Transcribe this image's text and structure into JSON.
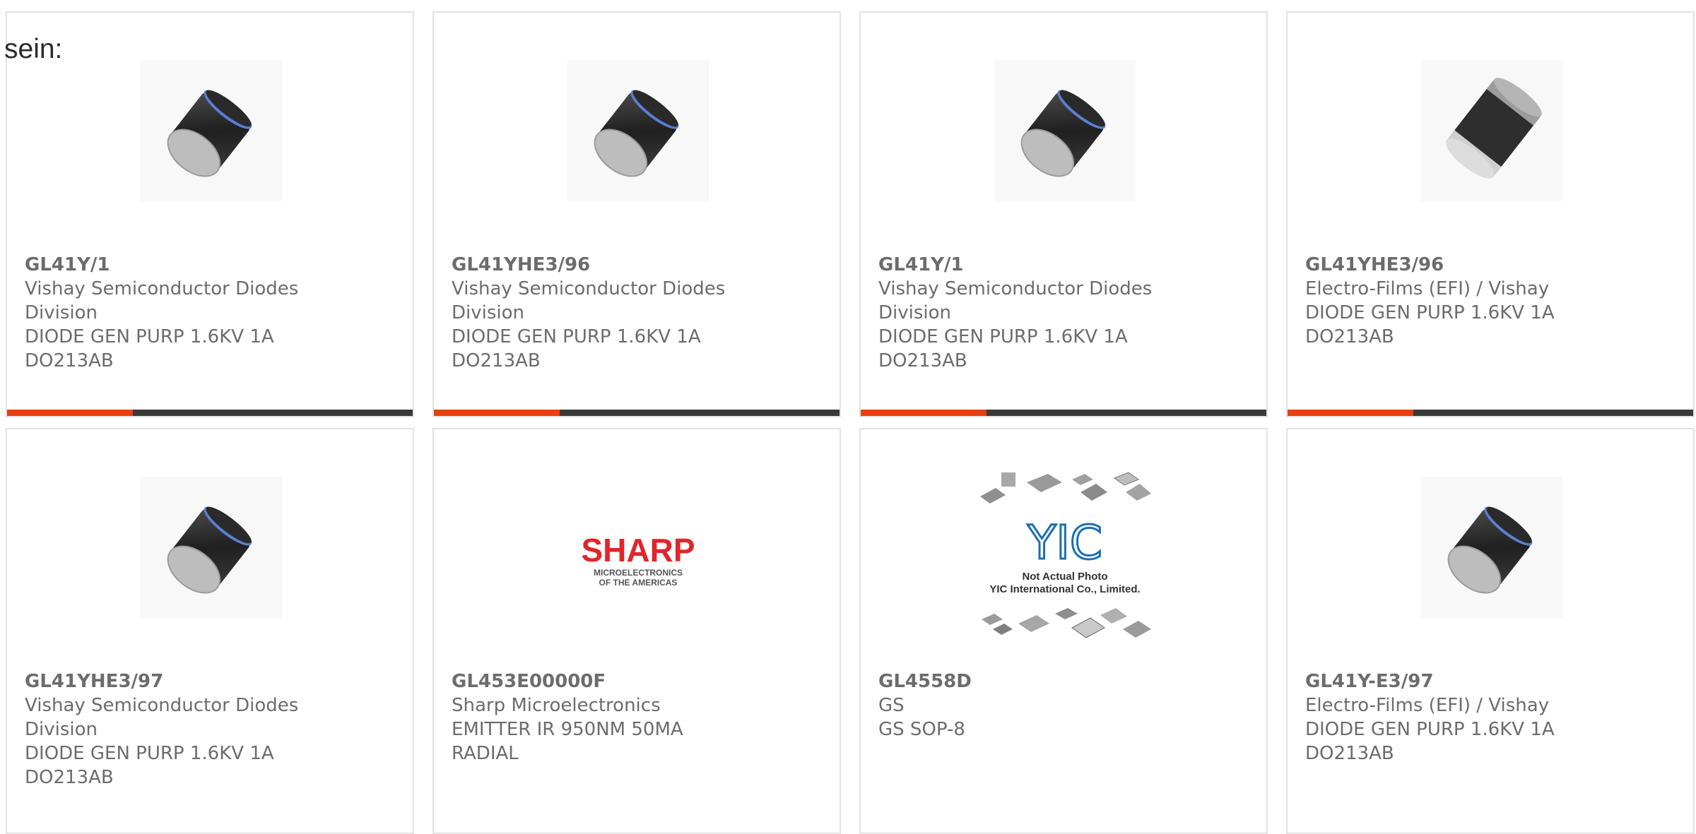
{
  "lead_text": "sein:",
  "colors": {
    "accent": "#e5400f",
    "bar_dark": "#3a3a3a",
    "text": "#6c6c6c",
    "border": "#e3e3e3"
  },
  "cards": [
    {
      "part": "GL41Y/1",
      "maker": "Vishay Semiconductor Diodes Division",
      "desc": "DIODE GEN PURP 1.6KV 1A DO213AB",
      "image": "diode-melf-icon"
    },
    {
      "part": "GL41YHE3/96",
      "maker": "Vishay Semiconductor Diodes Division",
      "desc": "DIODE GEN PURP 1.6KV 1A DO213AB",
      "image": "diode-melf-icon"
    },
    {
      "part": "GL41Y/1",
      "maker": "Vishay Semiconductor Diodes Division",
      "desc": "DIODE GEN PURP 1.6KV 1A DO213AB",
      "image": "diode-melf-icon"
    },
    {
      "part": "GL41YHE3/96",
      "maker": "Electro-Films (EFI) / Vishay",
      "desc": "DIODE GEN PURP 1.6KV 1A DO213AB",
      "image": "diode-melf-gray-icon"
    },
    {
      "part": "GL41YHE3/97",
      "maker": "Vishay Semiconductor Diodes Division",
      "desc": "DIODE GEN PURP 1.6KV 1A DO213AB",
      "image": "diode-melf-icon"
    },
    {
      "part": "GL453E00000F",
      "maker": "Sharp Microelectronics",
      "desc": "EMITTER IR 950NM 50MA RADIAL",
      "image": "sharp-logo",
      "logo": {
        "name": "SHARP",
        "line1": "MICROELECTRONICS",
        "line2": "OF THE AMERICAS"
      }
    },
    {
      "part": "GL4558D",
      "maker": "GS",
      "desc": "GS SOP-8",
      "image": "yic-placeholder",
      "logo": {
        "name": "YIC",
        "line1": "Not Actual Photo",
        "line2": "YIC International Co., Limited."
      }
    },
    {
      "part": "GL41Y-E3/97",
      "maker": "Electro-Films (EFI) / Vishay",
      "desc": "DIODE GEN PURP 1.6KV 1A DO213AB",
      "image": "diode-melf-icon"
    }
  ],
  "progress_fraction": 0.31
}
